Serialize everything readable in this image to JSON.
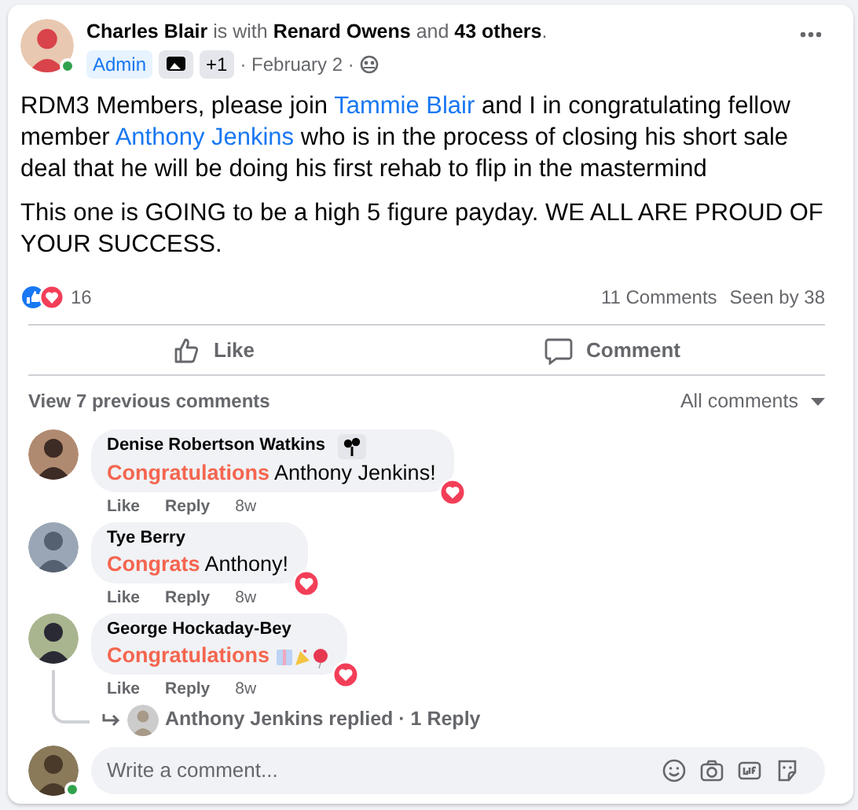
{
  "post": {
    "header": "**Charles Blair** is with **Renard Owens** and **43 others**.",
    "author_online": true,
    "badges": [
      {
        "kind": "role",
        "text": "Admin"
      },
      {
        "kind": "icon"
      },
      {
        "kind": "count",
        "text": "+1"
      }
    ],
    "date": "· February 2 ·",
    "paragraphs": [
      [
        {
          "kind": "text",
          "text": "RDM3 Members, please join "
        },
        {
          "kind": "link",
          "text": "Tammie Blair"
        },
        {
          "kind": "text",
          "text": " and I in congratulating fellow member "
        },
        {
          "kind": "link",
          "text": "Anthony Jenkins"
        },
        {
          "kind": "text",
          "text": " who is in the process of closing his short sale deal that he will be doing his first rehab to flip in the mastermind"
        }
      ],
      [
        {
          "kind": "text",
          "text": "This one is GOING to be a high 5 figure payday. WE ALL ARE PROUD OF YOUR SUCCESS."
        }
      ]
    ],
    "reaction_count": "16",
    "comments_count": "11 Comments",
    "seen_by": "Seen by 38"
  },
  "actions": [
    "Like",
    "Comment"
  ],
  "view_previous": "View 7 previous comments",
  "sort": "All comments",
  "comments": [
    {
      "author": "Denise Robertson Watkins",
      "badge": true,
      "highlight": "Congratulations",
      "rest": " Anthony Jenkins!",
      "actions": [
        "Like",
        "Reply",
        "8w"
      ],
      "loved": true
    },
    {
      "author": "Tye Berry",
      "highlight": "Congrats",
      "rest": " Anthony!",
      "actions": [
        "Like",
        "Reply",
        "8w"
      ],
      "loved": true
    },
    {
      "author": "George Hockaday-Bey",
      "highlight": "Congratulations",
      "emojis": true,
      "actions": [
        "Like",
        "Reply",
        "8w"
      ],
      "loved": true,
      "replies": "Anthony Jenkins replied · 1 Reply"
    }
  ],
  "composer": {
    "placeholder": "Write a comment...",
    "online": true
  }
}
